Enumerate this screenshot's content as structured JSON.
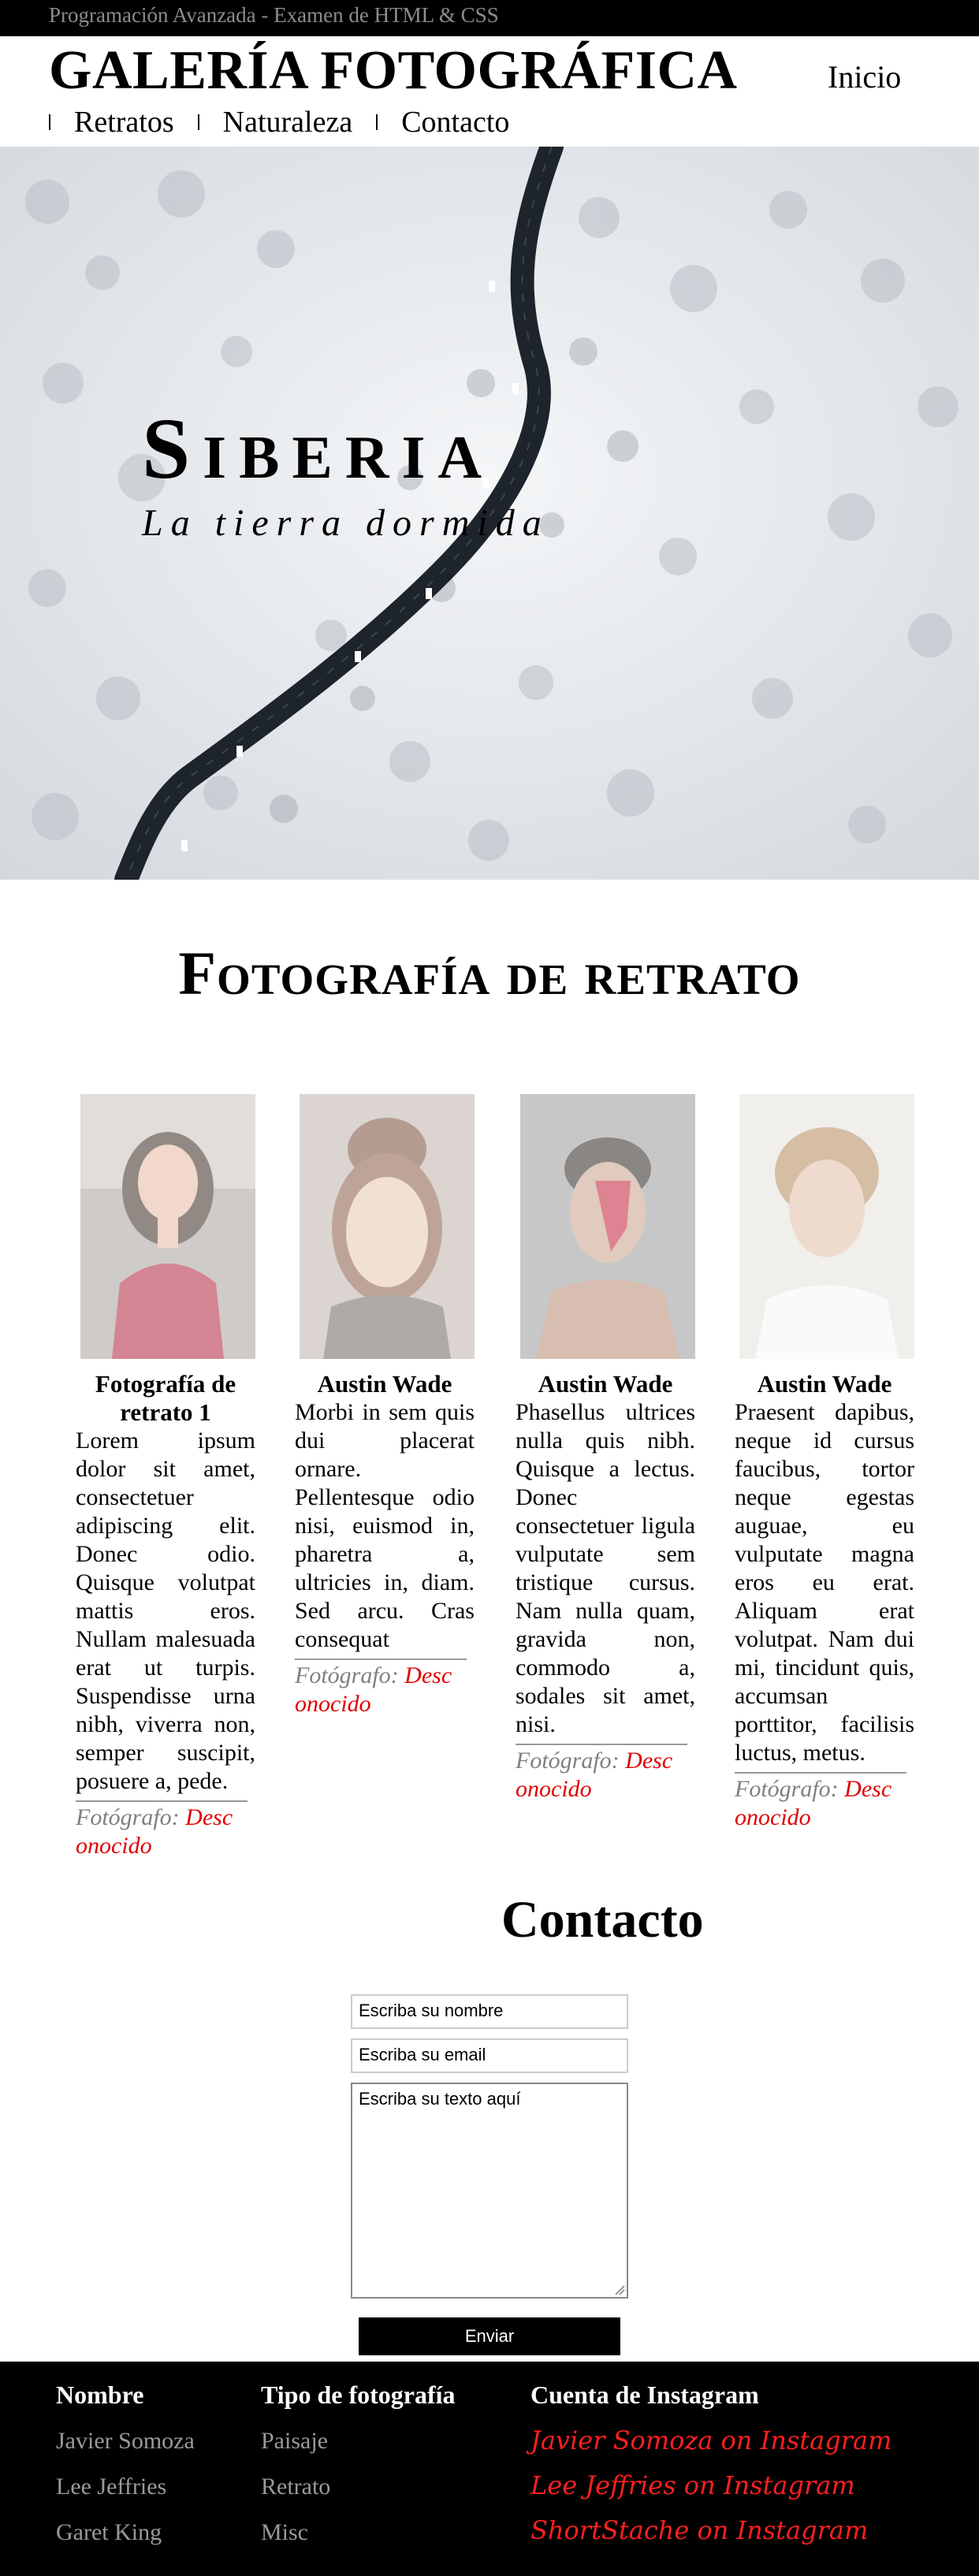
{
  "header": {
    "topbar_text": "Programación Avanzada - Examen de HTML & CSS",
    "brand": "GALERÍA FOTOGRÁFICA",
    "home_link": "Inicio",
    "nav": [
      "Retratos",
      "Naturaleza",
      "Contacto"
    ]
  },
  "hero": {
    "title": "Siberia",
    "subtitle": "La tierra dormida"
  },
  "portraits": {
    "title": "Fotografía de retrato",
    "cards": [
      {
        "name": "Fotografía de retrato 1",
        "text": "Lorem ipsum dolor sit amet, consectetuer adipiscing elit. Donec odio. Quisque volutpat mattis eros. Nullam malesuada erat ut turpis. Suspendisse urna nibh, viverra non, semper suscipit, posuere a, pede.",
        "credit_label": "Fotógrafo:",
        "credit_value": "Desc onocido"
      },
      {
        "name": "Austin Wade",
        "text": "Morbi in sem quis dui placerat ornare. Pellentesque odio nisi, euismod in, pharetra a, ultricies in, diam. Sed arcu. Cras consequat",
        "credit_label": "Fotógrafo:",
        "credit_value": "Desc onocido"
      },
      {
        "name": "Austin Wade",
        "text": "Phasellus ultrices nulla quis nibh. Quisque a lectus. Donec consectetuer ligula vulputate sem tristique cursus. Nam nulla quam, gravida non, commodo a, sodales sit amet, nisi.",
        "credit_label": "Fotógrafo:",
        "credit_value": "Desc onocido"
      },
      {
        "name": "Austin Wade",
        "text": "Praesent dapibus, neque id cursus faucibus, tortor neque egestas auguae, eu vulputate magna eros eu erat. Aliquam erat volutpat. Nam dui mi, tincidunt quis, accumsan porttitor, facilisis luctus, metus.",
        "credit_label": "Fotógrafo:",
        "credit_value": "Desc onocido"
      }
    ]
  },
  "contact": {
    "title": "Contacto",
    "name_placeholder": "Escriba su nombre",
    "email_placeholder": "Escriba su email",
    "message_placeholder": "Escriba su texto aquí",
    "submit_label": "Enviar"
  },
  "footer": {
    "col1": {
      "heading": "Nombre",
      "items": [
        "Javier Somoza",
        "Lee Jeffries",
        "Garet King"
      ]
    },
    "col2": {
      "heading": "Tipo de fotografía",
      "items": [
        "Paisaje",
        "Retrato",
        "Misc"
      ]
    },
    "col3": {
      "heading": "Cuenta de Instagram",
      "items": [
        "Javier Somoza on Instagram",
        "Lee Jeffries on Instagram",
        "ShortStache on Instagram"
      ]
    }
  },
  "colors": {
    "credit_accent": "#e00000",
    "instagram_link": "#ff1f1f",
    "footer_bg": "#000000"
  }
}
